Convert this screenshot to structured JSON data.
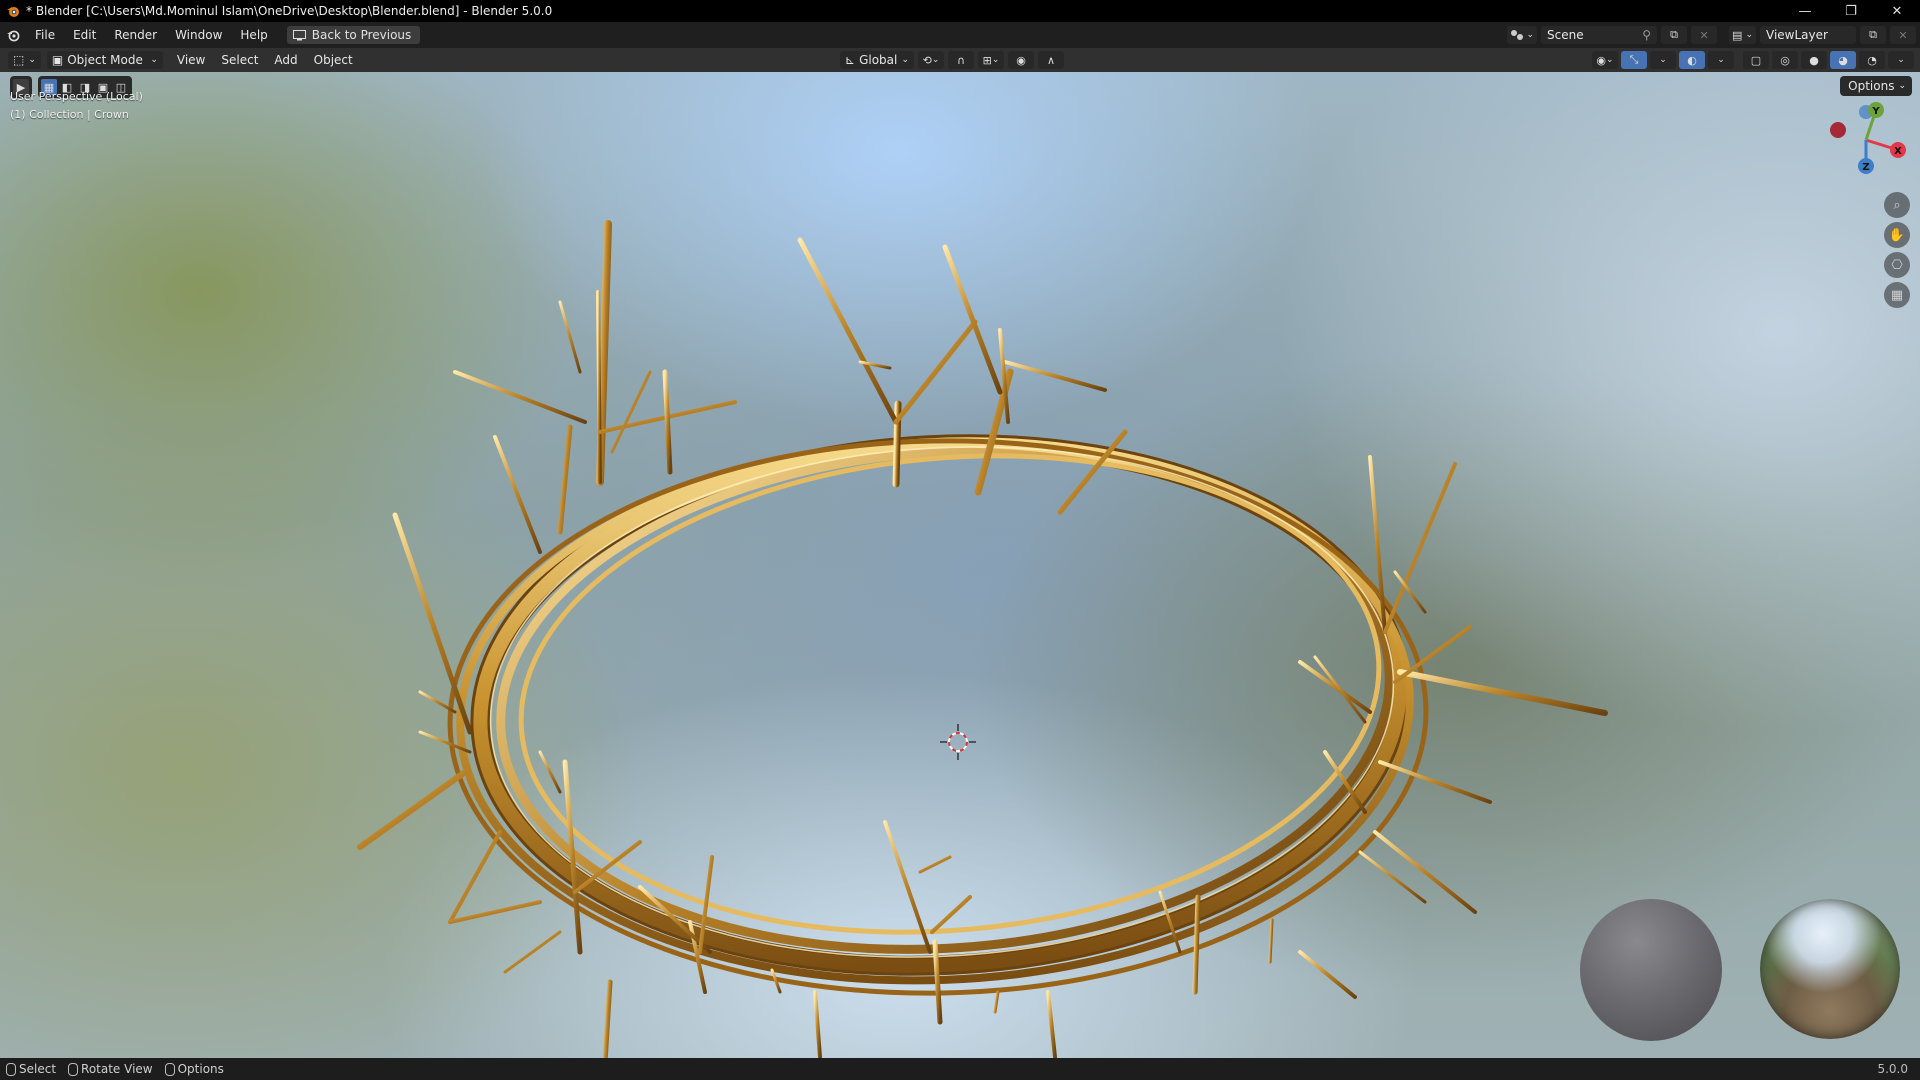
{
  "window": {
    "title": "* Blender [C:\\Users\\Md.Mominul Islam\\OneDrive\\Desktop\\Blender.blend] - Blender 5.0.0",
    "controls": [
      "—",
      "❐",
      "✕"
    ]
  },
  "menubar": {
    "items": [
      "File",
      "Edit",
      "Render",
      "Window",
      "Help"
    ],
    "back_button": "Back to Previous",
    "scene_label": "Scene",
    "viewlayer_label": "ViewLayer"
  },
  "header": {
    "mode": "Object Mode",
    "menus": [
      "View",
      "Select",
      "Add",
      "Object"
    ],
    "transform_orientation": "Global"
  },
  "viewport": {
    "overlay_line1": "User Perspective (Local)",
    "overlay_line2": "(1) Collection | Crown",
    "options_label": "Options",
    "gizmo_axes": [
      "X",
      "Y",
      "Z"
    ],
    "nav_icons": [
      "zoom-icon",
      "hand-pan-icon",
      "camera-icon",
      "grid-icon"
    ]
  },
  "statusbar": {
    "select": "Select",
    "rotate": "Rotate View",
    "options": "Options",
    "version": "5.0.0"
  },
  "colors": {
    "accent": "#4772b3",
    "gold_light": "#f3d27a",
    "gold_mid": "#c89232",
    "gold_dark": "#7a4d12",
    "axis_x": "#e2394a",
    "axis_y": "#6ea23a",
    "axis_z": "#3d7ec9"
  }
}
